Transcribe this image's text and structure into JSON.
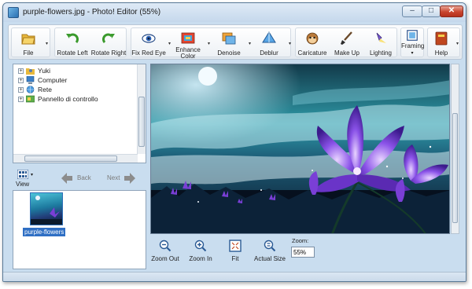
{
  "window": {
    "title": "purple-flowers.jpg - Photo! Editor (55%)"
  },
  "title_controls": {
    "minimize": "–",
    "maximize": "□",
    "close": "✕"
  },
  "toolbar": {
    "file": "File",
    "rotate_left": "Rotate Left",
    "rotate_right": "Rotate Right",
    "fix_red_eye": "Fix Red Eye",
    "enhance_color_1": "Enhance",
    "enhance_color_2": "Color",
    "denoise": "Denoise",
    "deblur": "Deblur",
    "caricature": "Caricature",
    "make_up": "Make Up",
    "lighting": "Lighting",
    "framing": "Framing",
    "help": "Help",
    "dropdown_glyph": "▾"
  },
  "tree": {
    "items": [
      {
        "label": "Yuki",
        "icon": "user-folder-icon"
      },
      {
        "label": "Computer",
        "icon": "computer-icon"
      },
      {
        "label": "Rete",
        "icon": "network-icon"
      },
      {
        "label": "Pannello di controllo",
        "icon": "control-panel-icon"
      }
    ],
    "expander": "+"
  },
  "nav": {
    "view": "View",
    "back": "Back",
    "next": "Next"
  },
  "thumbnails": [
    {
      "label": "purple-flowers"
    }
  ],
  "zoom_tools": {
    "zoom_out": "Zoom Out",
    "zoom_in": "Zoom In",
    "fit": "Fit",
    "actual_size": "Actual Size",
    "zoom_label": "Zoom:",
    "zoom_value": "55%"
  },
  "colors": {
    "accent": "#2f6fc4",
    "title_bar": "#c5d8ec",
    "close_button": "#c9452f",
    "flower_purple": "#7a3fd6"
  }
}
